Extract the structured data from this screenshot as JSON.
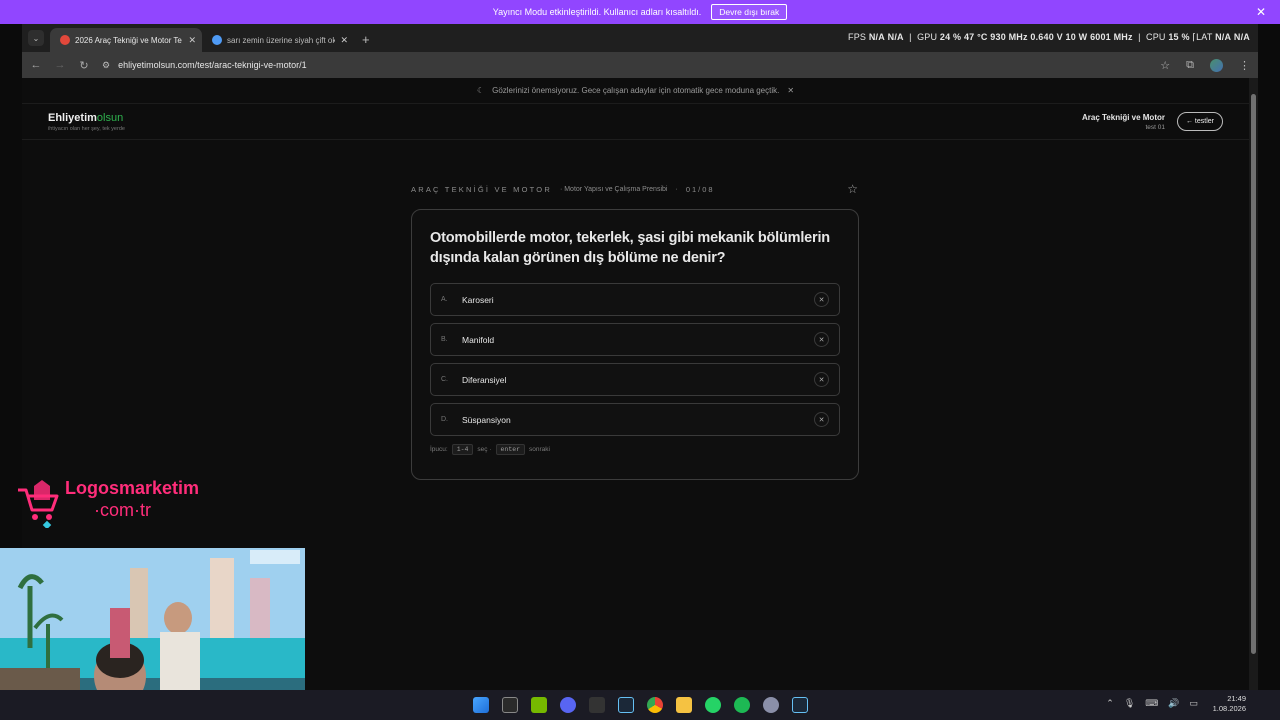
{
  "stream_bar": {
    "message": "Yayıncı Modu etkinleştirildi. Kullanıcı adları kısaltıldı.",
    "button": "Devre dışı bırak"
  },
  "browser": {
    "tabs": [
      {
        "title": "2026 Araç Tekniği ve Motor Te",
        "favicon_color": "#e2483b",
        "active": true
      },
      {
        "title": "sarı zemin üzerine siyah çift ok",
        "favicon_color": "#4f9bf5",
        "active": false
      }
    ],
    "url": "ehliyetimolsun.com/test/arac-teknigi-ve-motor/1"
  },
  "hud": {
    "fps_label": "FPS",
    "fps": "N/A",
    "fps2": "N/A",
    "gpu_label": "GPU",
    "gpu_load": "24 %",
    "gpu_temp": "47 °C",
    "gpu_clock": "930 MHz",
    "gpu_volt": "0.640 V",
    "gpu_power": "10 W",
    "gpu_mem": "6001 MHz",
    "cpu_label": "CPU",
    "cpu_load": "15 %",
    "lat_label": "LAT",
    "lat": "N/A",
    "lat2": "N/A"
  },
  "page": {
    "notice": "Gözlerinizi önemsiyoruz. Gece çalışan adaylar için otomatik gece moduna geçtik.",
    "brand_name": "Ehliyetim",
    "brand_accent": "olsun",
    "brand_tagline": "ihtiyacın olan her şey, tek yerde",
    "header_title": "Araç Tekniği ve Motor",
    "header_sub": "test 01",
    "back_button": "← testler",
    "category": "ARAÇ TEKNİĞİ VE MOTOR",
    "subtopic": "· Motor Yapısı ve Çalışma Prensibi",
    "dot": "·",
    "counter": "01/08",
    "question": "Otomobillerde motor, tekerlek, şasi gibi mekanik bölümlerin dışında kalan görünen dış bölüme ne denir?",
    "options": [
      {
        "letter": "A.",
        "text": "Karoseri"
      },
      {
        "letter": "B.",
        "text": "Manifold"
      },
      {
        "letter": "C.",
        "text": "Diferansiyel"
      },
      {
        "letter": "D.",
        "text": "Süspansiyon"
      }
    ],
    "hint_label": "İpucu:",
    "hint_key1": "1-4",
    "hint_text1": "seç ·",
    "hint_key2": "enter",
    "hint_text2": "sonraki"
  },
  "overlay": {
    "logo_line1": "Logosmarketim",
    "logo_line2": "·com·tr",
    "brand_color": "#ff2d7a"
  },
  "clock": {
    "time": "21:49",
    "date": "1.08.2026"
  }
}
